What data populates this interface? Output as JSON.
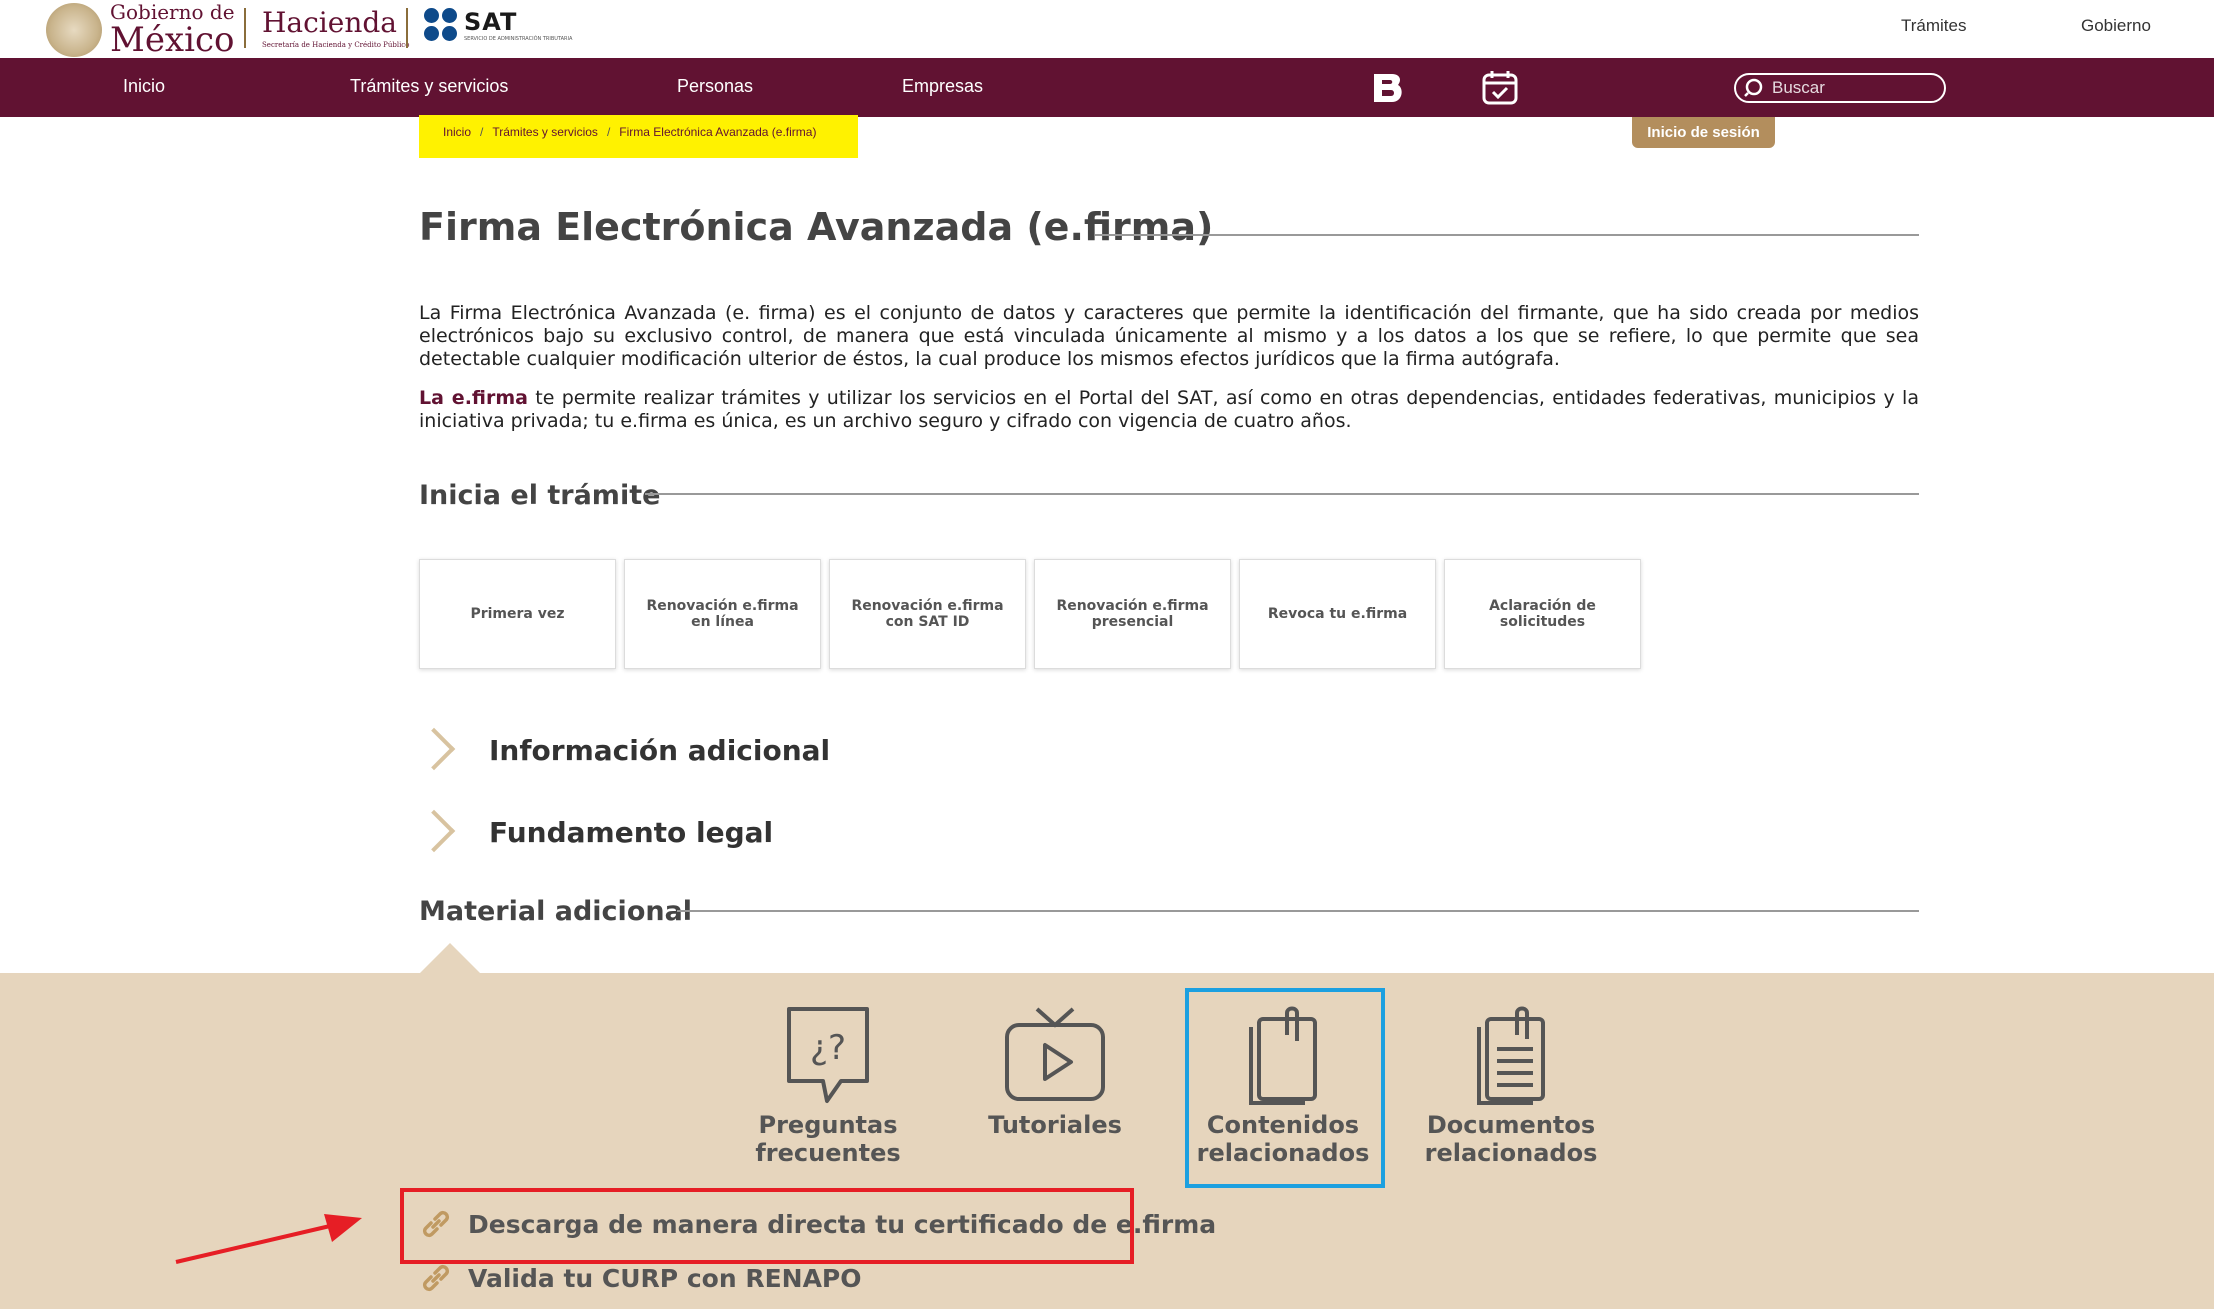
{
  "header": {
    "gob_line1": "Gobierno de",
    "gob_line2": "México",
    "hacienda": "Hacienda",
    "hacienda_sub": "Secretaría de Hacienda y Crédito Público",
    "sat": "SAT",
    "sat_sub": "SERVICIO DE ADMINISTRACIÓN TRIBUTARIA",
    "links": [
      "Trámites",
      "Gobierno"
    ]
  },
  "nav": {
    "items": [
      "Inicio",
      "Trámites y servicios",
      "Personas",
      "Empresas"
    ],
    "search_placeholder": "Buscar"
  },
  "breadcrumb": [
    "Inicio",
    "Trámites y servicios",
    "Firma Electrónica Avanzada (e.firma)"
  ],
  "login_label": "Inicio de sesión",
  "main": {
    "title": "Firma Electrónica Avanzada (e.firma)",
    "para1": "La Firma Electrónica Avanzada (e. firma) es el conjunto de datos y caracteres que permite la identificación del firmante, que ha sido creada por medios electrónicos bajo su exclusivo control, de manera que está vinculada únicamente al mismo y a los datos a los que se refiere, lo que permite que sea detectable cualquier modificación ulterior de éstos, la cual produce los mismos efectos jurídicos que la firma autógrafa.",
    "para2_lead": "La e.firma",
    "para2_rest": " te permite realizar trámites y utilizar los servicios en el Portal del SAT, así como en otras dependencias, entidades federativas, municipios y la iniciativa privada; tu e.firma es única, es un archivo seguro y cifrado con vigencia de cuatro años.",
    "inicia_title": "Inicia el trámite",
    "cards": [
      "Primera vez",
      "Renovación e.firma en línea",
      "Renovación e.firma con SAT ID",
      "Renovación e.firma presencial",
      "Revoca tu e.firma",
      "Aclaración de solicitudes"
    ],
    "accordion": [
      "Información adicional",
      "Fundamento legal"
    ],
    "material_title": "Material adicional"
  },
  "material": {
    "items": [
      "Preguntas frecuentes",
      "Tutoriales",
      "Contenidos relacionados",
      "Documentos relacionados"
    ],
    "faq_glyph": "¿?",
    "links": [
      "Descarga de manera directa tu certificado de e.firma",
      "Valida tu CURP con RENAPO"
    ]
  },
  "colors": {
    "brand": "#611232",
    "gold": "#b38e5d",
    "panel": "#e6d5bd",
    "annotation_yellow": "#fff200",
    "annotation_blue": "#1ca0e0",
    "annotation_red": "#e61e25"
  },
  "icons": [
    "bsat-icon",
    "calendar-icon",
    "search-icon",
    "chevron-right-icon",
    "faq-icon",
    "tv-icon",
    "clipboard-icon",
    "document-icon",
    "link-icon",
    "arrow-annotation"
  ]
}
